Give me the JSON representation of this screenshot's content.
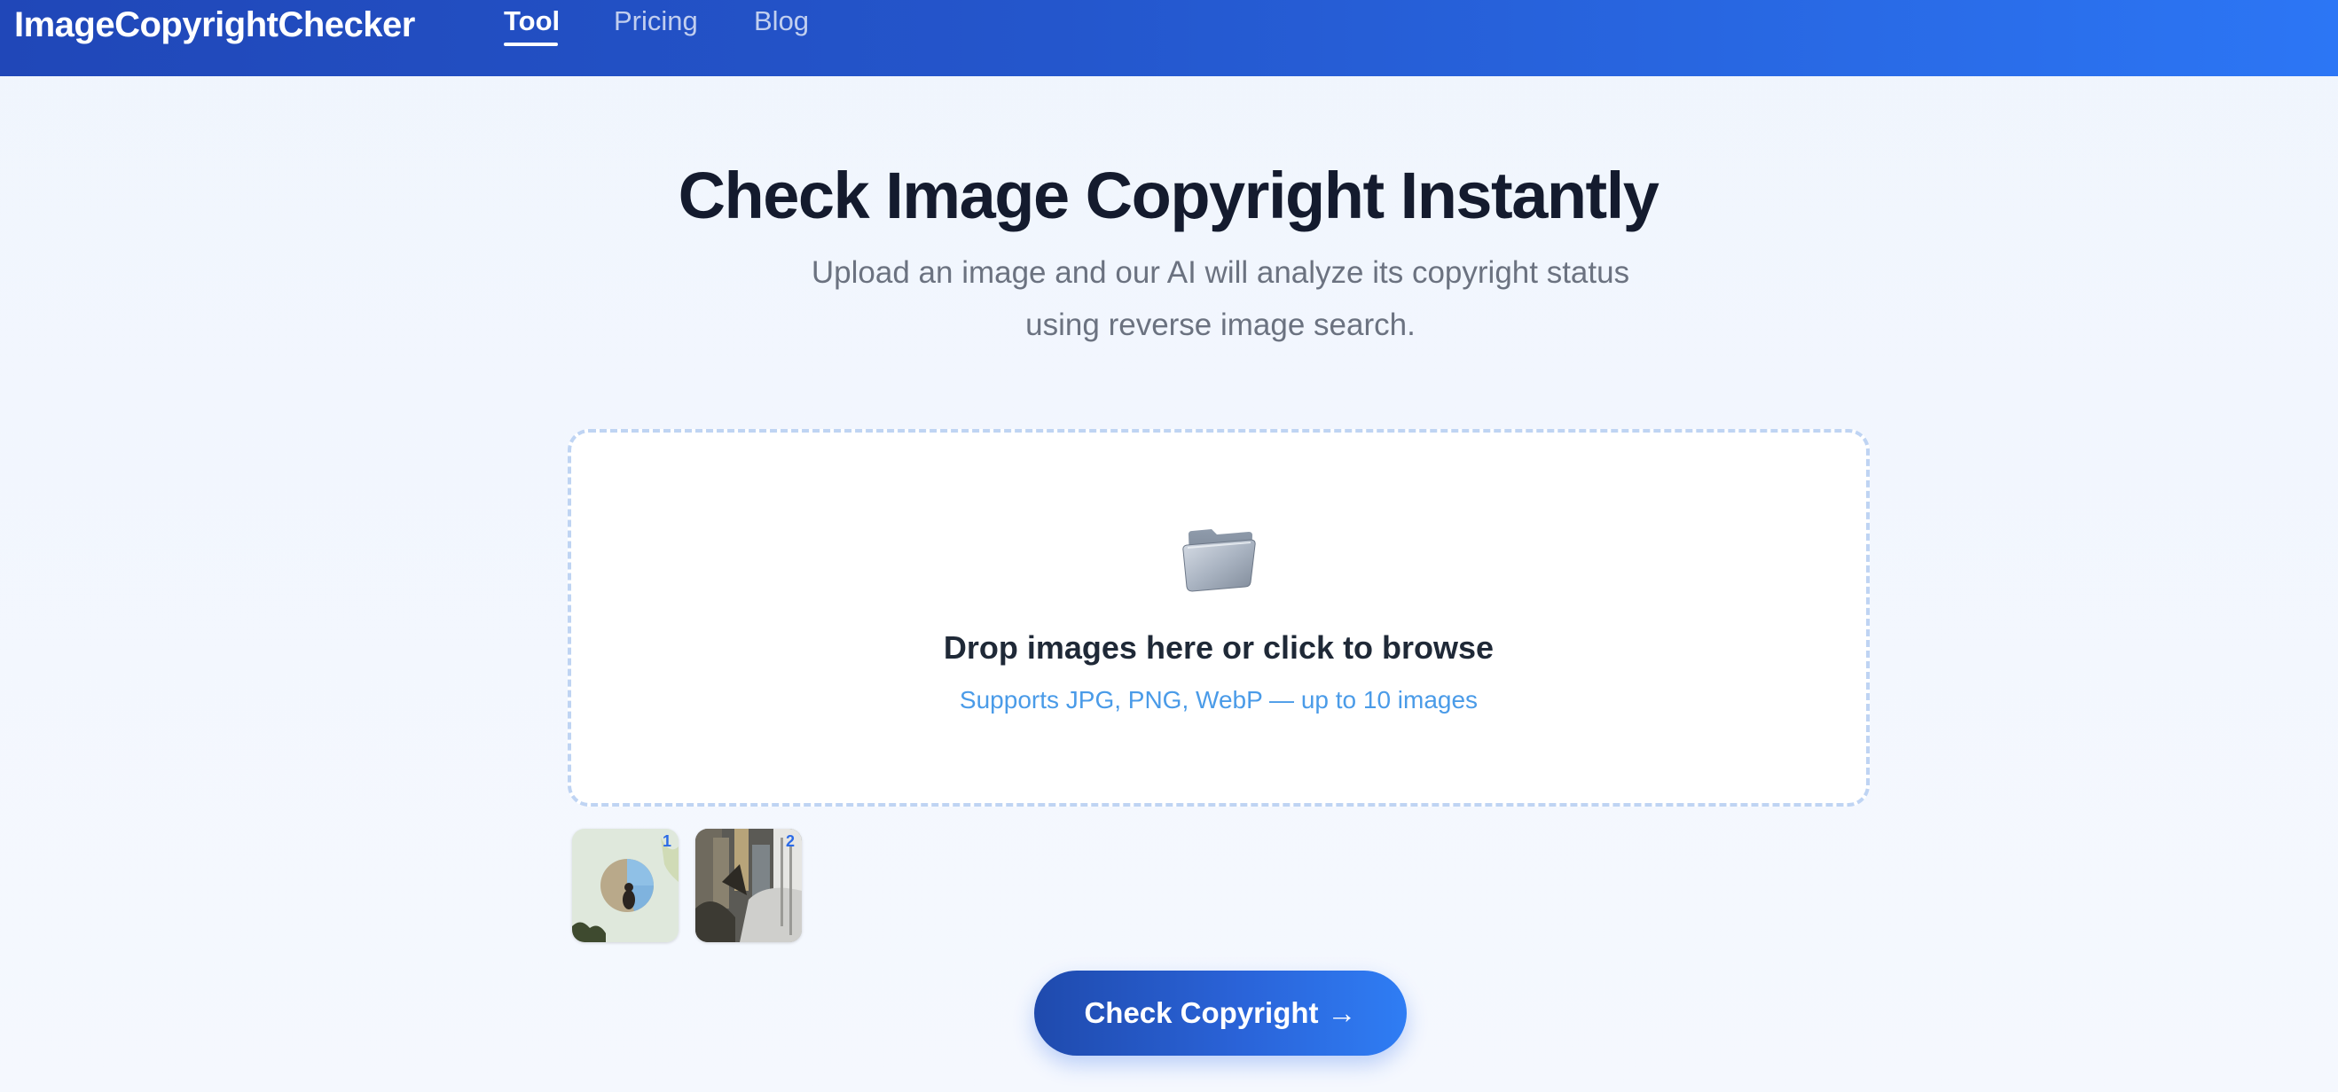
{
  "header": {
    "logo": "ImageCopyrightChecker",
    "nav": [
      {
        "label": "Tool",
        "active": true
      },
      {
        "label": "Pricing",
        "active": false
      },
      {
        "label": "Blog",
        "active": false
      }
    ]
  },
  "hero": {
    "title": "Check Image Copyright Instantly",
    "subtitle_line1": "Upload an image and our AI will analyze its copyright status",
    "subtitle_line2": "using reverse image search."
  },
  "dropzone": {
    "icon": "folder-icon",
    "title": "Drop images here or click to browse",
    "hint": "Supports JPG, PNG, WebP — up to 10 images"
  },
  "thumbnails": [
    {
      "badge": "1",
      "icon": "image-thumbnail"
    },
    {
      "badge": "2",
      "icon": "image-thumbnail"
    }
  ],
  "cta": {
    "label": "Check Copyright",
    "arrow": "→"
  },
  "colors": {
    "header_start": "#2047b8",
    "header_end": "#2c76f5",
    "title": "#141b2e",
    "subtitle": "#6b7280",
    "hint": "#4a9be8",
    "dropzone_border": "#bfd4f3",
    "cta_start": "#1f4aad",
    "cta_end": "#2f7df4"
  }
}
